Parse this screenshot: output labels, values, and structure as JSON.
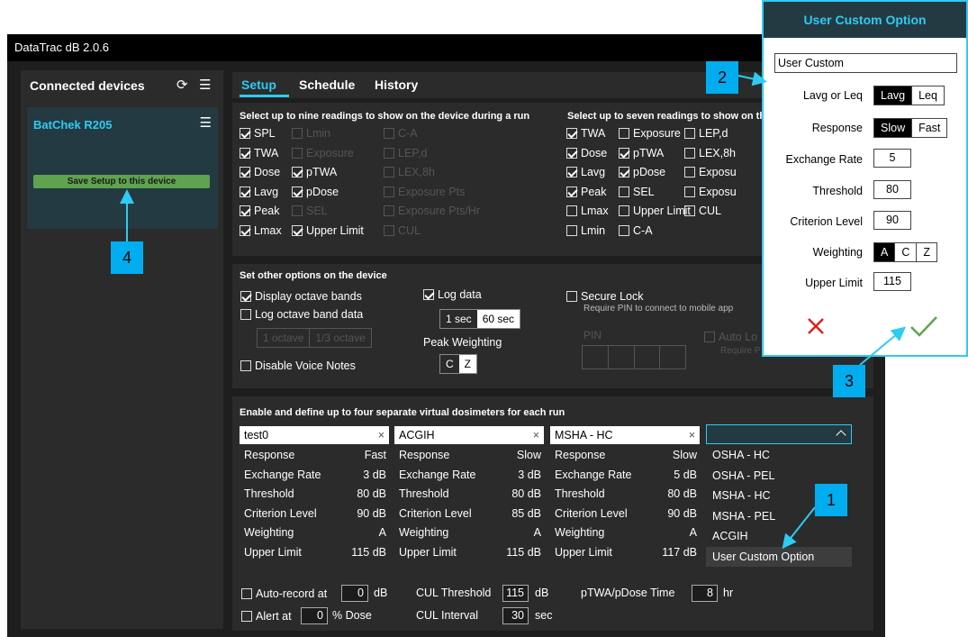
{
  "app": {
    "title": "DataTrac dB 2.0.6"
  },
  "left": {
    "header": "Connected devices",
    "refresh_icon": "refresh-icon",
    "menu_icon": "hamburger-icon",
    "device": {
      "name": "BatChek R205",
      "save_label": "Save Setup to this device"
    }
  },
  "tabs": [
    "Setup",
    "Schedule",
    "History"
  ],
  "readings": {
    "left_title": "Select up to nine readings to show on the device during a run",
    "right_title": "Select up to seven readings to show on th",
    "left": [
      {
        "label": "SPL",
        "checked": true,
        "enabled": true
      },
      {
        "label": "Lmin",
        "checked": false,
        "enabled": false
      },
      {
        "label": "C-A",
        "checked": false,
        "enabled": false
      },
      {
        "label": "TWA",
        "checked": true,
        "enabled": true
      },
      {
        "label": "Exposure",
        "checked": false,
        "enabled": false
      },
      {
        "label": "LEP,d",
        "checked": false,
        "enabled": false
      },
      {
        "label": "Dose",
        "checked": true,
        "enabled": true
      },
      {
        "label": "pTWA",
        "checked": true,
        "enabled": true
      },
      {
        "label": "LEX,8h",
        "checked": false,
        "enabled": false
      },
      {
        "label": "Lavg",
        "checked": true,
        "enabled": true
      },
      {
        "label": "pDose",
        "checked": true,
        "enabled": true
      },
      {
        "label": "Exposure Pts",
        "checked": false,
        "enabled": false
      },
      {
        "label": "Peak",
        "checked": true,
        "enabled": true
      },
      {
        "label": "SEL",
        "checked": false,
        "enabled": false
      },
      {
        "label": "Exposure Pts/Hr",
        "checked": false,
        "enabled": false
      },
      {
        "label": "Lmax",
        "checked": true,
        "enabled": true
      },
      {
        "label": "Upper Limit",
        "checked": true,
        "enabled": true
      },
      {
        "label": "CUL",
        "checked": false,
        "enabled": false
      }
    ],
    "right": [
      {
        "label": "TWA",
        "checked": true
      },
      {
        "label": "Exposure",
        "checked": false
      },
      {
        "label": "LEP,d",
        "checked": false
      },
      {
        "label": "Dose",
        "checked": true
      },
      {
        "label": "pTWA",
        "checked": true
      },
      {
        "label": "LEX,8h",
        "checked": false
      },
      {
        "label": "Lavg",
        "checked": true
      },
      {
        "label": "pDose",
        "checked": true
      },
      {
        "label": "Exposu",
        "checked": false
      },
      {
        "label": "Peak",
        "checked": true
      },
      {
        "label": "SEL",
        "checked": false
      },
      {
        "label": "Exposu",
        "checked": false
      },
      {
        "label": "Lmax",
        "checked": false
      },
      {
        "label": "Upper Limit",
        "checked": false
      },
      {
        "label": "CUL",
        "checked": false
      },
      {
        "label": "Lmin",
        "checked": false
      },
      {
        "label": "C-A",
        "checked": false
      },
      {
        "label": "",
        "checked": false
      }
    ]
  },
  "options": {
    "title": "Set other options on the device",
    "display_octave": "Display octave bands",
    "log_octave": "Log octave band data",
    "octave_opts": [
      "1 octave",
      "1/3 octave"
    ],
    "disable_voice": "Disable Voice Notes",
    "log_data": "Log data",
    "log_rates": [
      "1 sec",
      "60 sec"
    ],
    "peak_weighting_label": "Peak Weighting",
    "peak_weighting": [
      "C",
      "Z"
    ],
    "secure_lock": "Secure Lock",
    "secure_hint": "Require PIN to connect to mobile app",
    "pin_label": "PIN",
    "auto_lock": "Auto Lo",
    "auto_hint": "Require P"
  },
  "dosimeters": {
    "title": "Enable and define up to four separate virtual dosimeters for each run",
    "row_labels": [
      "Response",
      "Exchange Rate",
      "Threshold",
      "Criterion Level",
      "Weighting",
      "Upper Limit"
    ],
    "columns": [
      {
        "name": "test0",
        "values": [
          "Fast",
          "3 dB",
          "80 dB",
          "90 dB",
          "A",
          "115 dB"
        ]
      },
      {
        "name": "ACGIH",
        "values": [
          "Slow",
          "3 dB",
          "80 dB",
          "85 dB",
          "A",
          "115 dB"
        ]
      },
      {
        "name": "MSHA - HC",
        "values": [
          "Slow",
          "5 dB",
          "80 dB",
          "90 dB",
          "A",
          "117 dB"
        ]
      }
    ],
    "close_glyph": "×",
    "dropdown_options": [
      "OSHA - HC",
      "OSHA - PEL",
      "MSHA - HC",
      "MSHA - PEL",
      "ACGIH",
      "User Custom Option"
    ]
  },
  "bottom": {
    "auto_record": "Auto-record at",
    "auto_record_value": "0",
    "auto_record_unit": "dB",
    "alert": "Alert at",
    "alert_value": "0",
    "alert_unit": "% Dose",
    "cul_threshold": "CUL Threshold",
    "cul_threshold_value": "115",
    "cul_threshold_unit": "dB",
    "cul_interval": "CUL Interval",
    "cul_interval_value": "30",
    "cul_interval_unit": "sec",
    "ptwa_time": "pTWA/pDose Time",
    "ptwa_time_value": "8",
    "ptwa_time_unit": "hr"
  },
  "dialog": {
    "title": "User Custom Option",
    "name_value": "User Custom",
    "lavg_label": "Lavg or Leq",
    "lavg_opts": [
      "Lavg",
      "Leq"
    ],
    "response_label": "Response",
    "response_opts": [
      "Slow",
      "Fast"
    ],
    "exchange_label": "Exchange Rate",
    "exchange_value": "5",
    "threshold_label": "Threshold",
    "threshold_value": "80",
    "criterion_label": "Criterion Level",
    "criterion_value": "90",
    "weighting_label": "Weighting",
    "weighting_opts": [
      "A",
      "C",
      "Z"
    ],
    "upper_label": "Upper Limit",
    "upper_value": "115",
    "cancel_icon": "x-icon",
    "ok_icon": "check-icon",
    "cancel_color": "#e02020",
    "ok_color": "#5ea34e"
  },
  "callouts": [
    "1",
    "2",
    "3",
    "4"
  ],
  "colors": {
    "accent": "#2ecbf2",
    "callout": "#00aeef",
    "save_button": "#5ea34e"
  }
}
